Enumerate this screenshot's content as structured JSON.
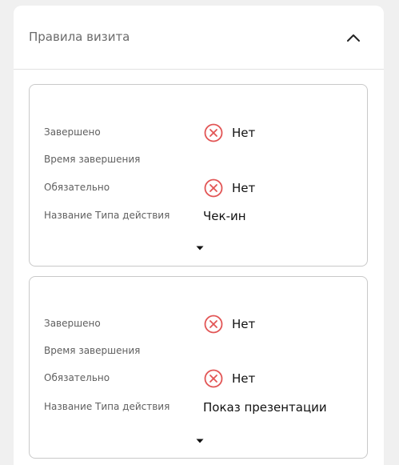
{
  "panel": {
    "title": "Правила визита"
  },
  "cards": [
    {
      "completed_label": "Завершено",
      "completed_value": "Нет",
      "completion_time_label": "Время завершения",
      "mandatory_label": "Обязательно",
      "mandatory_value": "Нет",
      "action_type_label": "Название Типа действия",
      "action_type_value": "Чек-ин"
    },
    {
      "completed_label": "Завершено",
      "completed_value": "Нет",
      "completion_time_label": "Время завершения",
      "mandatory_label": "Обязательно",
      "mandatory_value": "Нет",
      "action_type_label": "Название Типа действия",
      "action_type_value": "Показ презентации"
    }
  ],
  "colors": {
    "no_status": "#e25555"
  },
  "icons": {
    "collapse": "chevron-up-icon",
    "status_no": "x-circle-icon",
    "expand": "caret-down-icon"
  }
}
